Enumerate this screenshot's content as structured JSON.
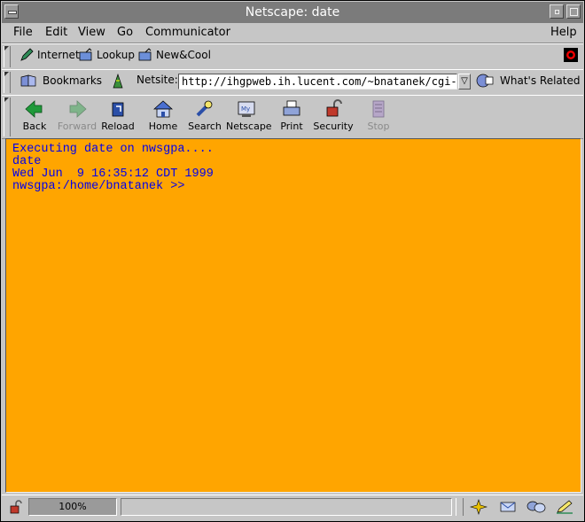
{
  "window": {
    "title": "Netscape: date"
  },
  "menu": {
    "file": "File",
    "edit": "Edit",
    "view": "View",
    "go": "Go",
    "communicator": "Communicator",
    "help": "Help"
  },
  "personal_toolbar": {
    "internet": "Internet",
    "lookup": "Lookup",
    "newcool": "New&Cool"
  },
  "location_toolbar": {
    "bookmarks": "Bookmarks",
    "netsite_label": "Netsite:",
    "url": "http://ihgpweb.ih.lucent.com/~bnatanek/cgi-b",
    "whats_related": "What's Related"
  },
  "nav_toolbar": {
    "back": "Back",
    "forward": "Forward",
    "reload": "Reload",
    "home": "Home",
    "search": "Search",
    "netscape": "Netscape",
    "print": "Print",
    "security": "Security",
    "stop": "Stop"
  },
  "page": {
    "lines": [
      "Executing date on nwsgpa....",
      "date",
      "Wed Jun  9 16:35:12 CDT 1999",
      "nwsgpa:/home/bnatanek >>"
    ],
    "background_color": "#ffa500",
    "text_color": "#0000ee"
  },
  "status": {
    "progress": "100%"
  }
}
